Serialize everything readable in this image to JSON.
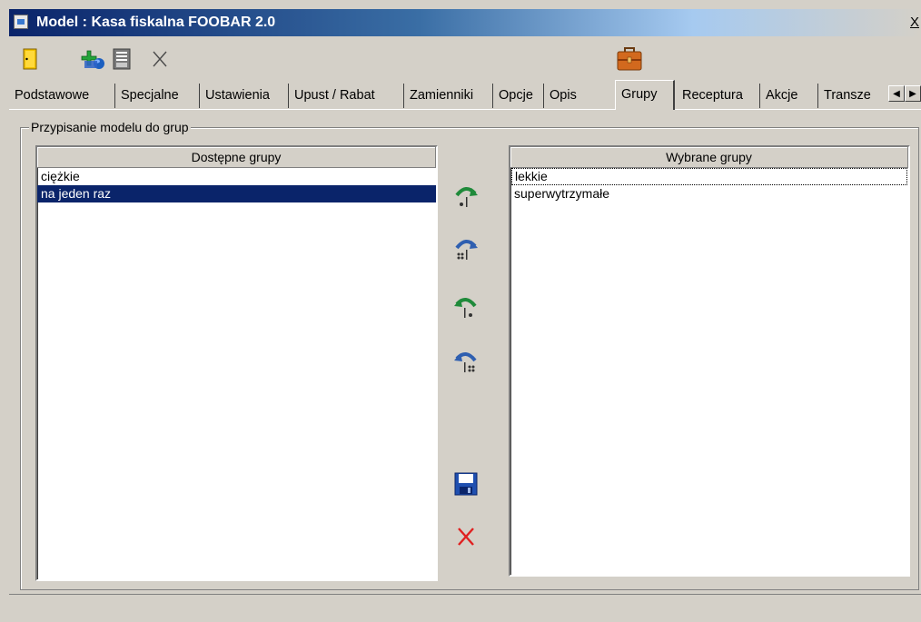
{
  "window": {
    "title": "Model : Kasa fiskalna FOOBAR 2.0",
    "close_label": "X"
  },
  "toolbar": {
    "buttons": [
      "exit-door-icon",
      "add-to-group-icon",
      "save-document-icon",
      "cancel-x-icon",
      "briefcase-icon"
    ]
  },
  "tabs": [
    {
      "label": "Podstawowe"
    },
    {
      "label": "Specjalne"
    },
    {
      "label": "Ustawienia"
    },
    {
      "label": "Upust / Rabat"
    },
    {
      "label": "Zamienniki"
    },
    {
      "label": "Opcje"
    },
    {
      "label": "Opis"
    },
    {
      "label": "Grupy",
      "active": true
    },
    {
      "label": "Receptura"
    },
    {
      "label": "Akcje"
    },
    {
      "label": "Transze"
    }
  ],
  "groupbox": {
    "label": "Przypisanie modelu do grup"
  },
  "available": {
    "header": "Dostępne grupy",
    "items": [
      "ciężkie",
      "na jeden raz"
    ],
    "selected_index": 1
  },
  "chosen": {
    "header": "Wybrane grupy",
    "items": [
      "lekkie",
      "superwytrzymałe"
    ],
    "focused_index": 0
  },
  "colors": {
    "selection": "#0a246a",
    "arrow_green": "#1f8a3a",
    "arrow_blue": "#2f5fb0",
    "cancel_red": "#e02020"
  }
}
